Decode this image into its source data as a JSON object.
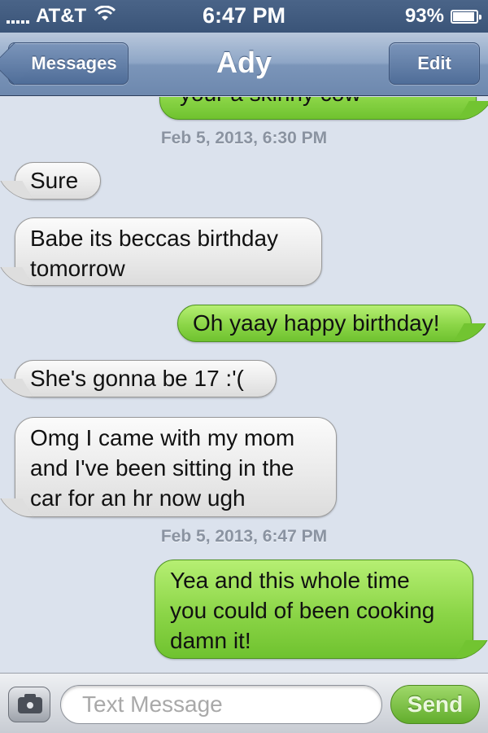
{
  "status_bar": {
    "carrier": "AT&T",
    "time": "6:47 PM",
    "battery": "93%",
    "battery_level": 0.93
  },
  "nav": {
    "back_label": "Messages",
    "title": "Ady",
    "edit_label": "Edit"
  },
  "conversation": {
    "partial_message": "your a skinny cow",
    "timestamps": [
      "Feb 5, 2013, 6:30 PM",
      "Feb 5, 2013, 6:47 PM"
    ],
    "messages": [
      {
        "from": "them",
        "text": "Sure"
      },
      {
        "from": "them",
        "text": "Babe its beccas birthday\ntomorrow"
      },
      {
        "from": "me",
        "text": "Oh yaay happy birthday!"
      },
      {
        "from": "them",
        "text": "She's gonna be 17 :'("
      },
      {
        "from": "them",
        "text": "Omg I came with my mom\nand I've been sitting in the\ncar for an hr now ugh"
      },
      {
        "from": "me",
        "text": "Yea and this whole time\nyou could of been cooking\ndamn it!"
      }
    ]
  },
  "input_bar": {
    "camera_icon": "camera-icon",
    "placeholder": "Text Message",
    "value": "",
    "send_label": "Send"
  },
  "colors": {
    "background": "#dbe2ed",
    "outgoing_bubble": "#8bd547",
    "incoming_bubble": "#e9e9e9",
    "nav_bar": "#7b95b9"
  }
}
